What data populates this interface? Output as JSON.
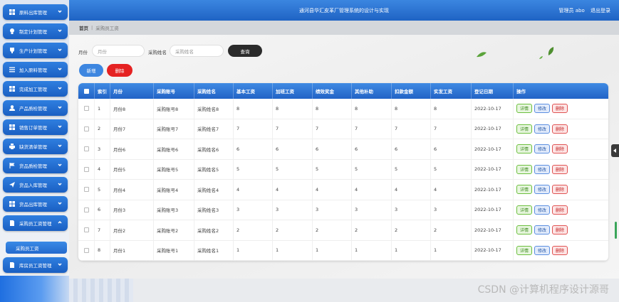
{
  "header": {
    "title": "通河县华汇皮革厂管理系统的设计与实现",
    "user_label": "管理员 abo",
    "logout_label": "退出登录"
  },
  "breadcrumb": {
    "home": "首页",
    "separator": "|",
    "current": "采购员工资"
  },
  "sidebar": {
    "items": [
      {
        "label": "原料出库管理",
        "icon": "grid-icon"
      },
      {
        "label": "制定计划管理",
        "icon": "bulb-icon"
      },
      {
        "label": "生产计划管理",
        "icon": "trophy-icon"
      },
      {
        "label": "加入原料管理",
        "icon": "list-icon"
      },
      {
        "label": "完成加工管理",
        "icon": "grid-icon"
      },
      {
        "label": "产品质检管理",
        "icon": "user-icon"
      },
      {
        "label": "销售订单管理",
        "icon": "grid-icon"
      },
      {
        "label": "缺货清单管理",
        "icon": "print-icon"
      },
      {
        "label": "货品质检管理",
        "icon": "flag-icon"
      },
      {
        "label": "货品入库管理",
        "icon": "send-icon"
      },
      {
        "label": "货品出库管理",
        "icon": "grid-icon"
      },
      {
        "label": "采购员工资管理",
        "icon": "doc-icon"
      }
    ],
    "sub_item": "采购员工资",
    "last_item": {
      "label": "库房员工资管理",
      "icon": "doc-icon"
    }
  },
  "search": {
    "month_label": "月份",
    "month_placeholder": "月份",
    "name_label": "采购姓名",
    "name_placeholder": "采购姓名",
    "search_button": "查询"
  },
  "actions": {
    "add_label": "新增",
    "delete_label": "删除"
  },
  "table": {
    "headers": [
      "索引",
      "月份",
      "采购账号",
      "采购姓名",
      "基本工资",
      "加班工资",
      "绩效奖金",
      "其他补助",
      "扣款金额",
      "实发工资",
      "登记日期",
      "操作"
    ],
    "row_buttons": {
      "view": "详情",
      "edit": "修改",
      "delete": "删除"
    },
    "rows": [
      {
        "idx": "1",
        "month": "月份8",
        "account": "采购账号8",
        "name": "采购姓名8",
        "base": "8",
        "overtime": "8",
        "bonus": "8",
        "other": "8",
        "deduct": "8",
        "actual": "8",
        "date": "2022-10-17"
      },
      {
        "idx": "2",
        "month": "月份7",
        "account": "采购账号7",
        "name": "采购姓名7",
        "base": "7",
        "overtime": "7",
        "bonus": "7",
        "other": "7",
        "deduct": "7",
        "actual": "7",
        "date": "2022-10-17"
      },
      {
        "idx": "3",
        "month": "月份6",
        "account": "采购账号6",
        "name": "采购姓名6",
        "base": "6",
        "overtime": "6",
        "bonus": "6",
        "other": "6",
        "deduct": "6",
        "actual": "6",
        "date": "2022-10-17"
      },
      {
        "idx": "4",
        "month": "月份5",
        "account": "采购账号5",
        "name": "采购姓名5",
        "base": "5",
        "overtime": "5",
        "bonus": "5",
        "other": "5",
        "deduct": "5",
        "actual": "5",
        "date": "2022-10-17"
      },
      {
        "idx": "5",
        "month": "月份4",
        "account": "采购账号4",
        "name": "采购姓名4",
        "base": "4",
        "overtime": "4",
        "bonus": "4",
        "other": "4",
        "deduct": "4",
        "actual": "4",
        "date": "2022-10-17"
      },
      {
        "idx": "6",
        "month": "月份3",
        "account": "采购账号3",
        "name": "采购姓名3",
        "base": "3",
        "overtime": "3",
        "bonus": "3",
        "other": "3",
        "deduct": "3",
        "actual": "3",
        "date": "2022-10-17"
      },
      {
        "idx": "7",
        "month": "月份2",
        "account": "采购账号2",
        "name": "采购姓名2",
        "base": "2",
        "overtime": "2",
        "bonus": "2",
        "other": "2",
        "deduct": "2",
        "actual": "2",
        "date": "2022-10-17"
      },
      {
        "idx": "8",
        "month": "月份1",
        "account": "采购账号1",
        "name": "采购姓名1",
        "base": "1",
        "overtime": "1",
        "bonus": "1",
        "other": "1",
        "deduct": "1",
        "actual": "1",
        "date": "2022-10-17"
      }
    ]
  },
  "watermark": "CSDN @计算机程序设计源哥",
  "colors": {
    "primary": "#2263c6",
    "danger": "#e52222",
    "dark_button": "#2b2b2b"
  }
}
